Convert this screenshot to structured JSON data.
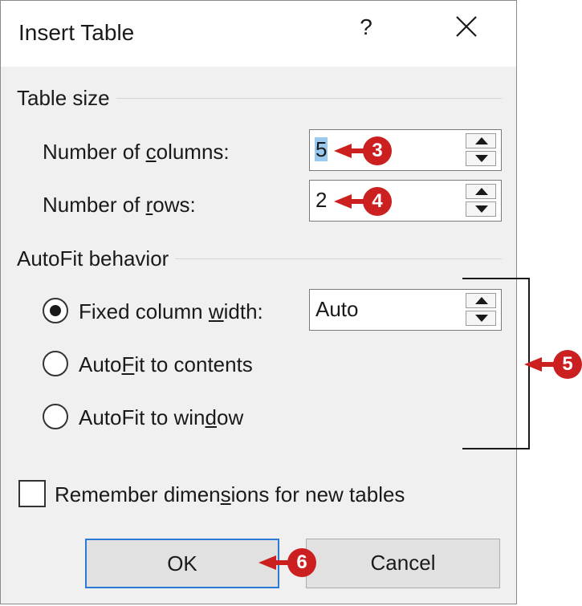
{
  "dialog": {
    "title": "Insert Table",
    "help_label": "?"
  },
  "table_size": {
    "group_label": "Table size",
    "columns_label_pre": "Number of ",
    "columns_label_u": "c",
    "columns_label_post": "olumns:",
    "columns_value": "5",
    "rows_label_pre": "Number of ",
    "rows_label_u": "r",
    "rows_label_post": "ows:",
    "rows_value": "2"
  },
  "autofit": {
    "group_label": "AutoFit behavior",
    "fixed_label_pre": "Fixed column ",
    "fixed_label_u": "w",
    "fixed_label_post": "idth:",
    "fixed_value": "Auto",
    "contents_label_pre": "Auto",
    "contents_label_u": "F",
    "contents_label_post": "it to contents",
    "window_label_pre": "AutoFit to win",
    "window_label_u": "d",
    "window_label_post": "ow",
    "selected_option": "fixed"
  },
  "remember": {
    "label_pre": "Remember dimen",
    "label_u": "s",
    "label_post": "ions for new tables",
    "checked": false
  },
  "buttons": {
    "ok_label": "OK",
    "cancel_label": "Cancel"
  },
  "callouts": {
    "columns": "3",
    "rows": "4",
    "autofit": "5",
    "ok": "6"
  },
  "colors": {
    "callout_red": "#cc1f1f",
    "selection_blue": "#99c9ef",
    "ok_border": "#2a7ad6"
  },
  "icons": {
    "close": "close-icon",
    "spin_up": "chevron-up-icon",
    "spin_down": "chevron-down-icon",
    "callout": "callout-arrow-icon"
  }
}
